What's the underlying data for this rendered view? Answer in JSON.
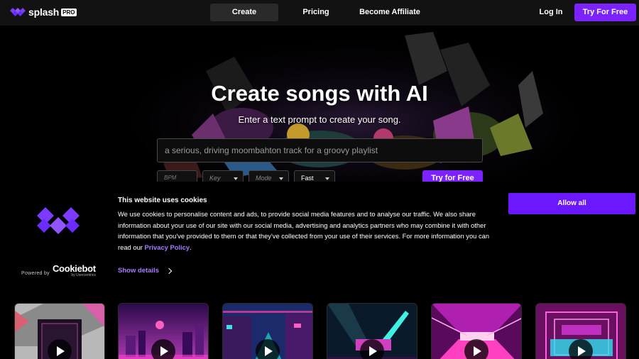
{
  "nav": {
    "brand": "splash",
    "brand_badge": "PRO",
    "links": [
      "Create",
      "Pricing",
      "Become Affiliate"
    ],
    "login": "Log In",
    "cta": "Try For Free"
  },
  "hero": {
    "title": "Create songs with AI",
    "subtitle": "Enter a text prompt to create your song.",
    "prompt_placeholder": "a serious, driving moombahton track for a groovy playlist",
    "controls": {
      "bpm_placeholder": "BPM",
      "key_placeholder": "Key",
      "mode_placeholder": "Mode",
      "speed_value": "Fast"
    },
    "cta": "Try for Free"
  },
  "cookie": {
    "title": "This website uses cookies",
    "body": "We use cookies to personalise content and ads, to provide social media features and to analyse our traffic. We also share information about your use of our site with our social media, advertising and analytics partners who may combine it with other information that you've provided to them or that they've collected from your use of their services. For more information you can read our ",
    "privacy_link": "Privacy Policy",
    "body_end": ".",
    "show_details": "Show details",
    "allow_all": "Allow all",
    "powered_by": "Powered by",
    "powered_brand": "Cookiebot",
    "powered_sub": "by Usercentrics"
  },
  "colors": {
    "accent": "#7b22ff",
    "link": "#a77bff",
    "background": "#000000",
    "nav_bg": "#121212"
  },
  "icons": [
    "splash-logo-icon",
    "cookiebot-logo-icon",
    "chevron-right-icon",
    "play-icon",
    "chevron-down-icon"
  ],
  "cards": [
    {
      "name": "track-card-1"
    },
    {
      "name": "track-card-2"
    },
    {
      "name": "track-card-3"
    },
    {
      "name": "track-card-4"
    },
    {
      "name": "track-card-5"
    },
    {
      "name": "track-card-6"
    }
  ]
}
